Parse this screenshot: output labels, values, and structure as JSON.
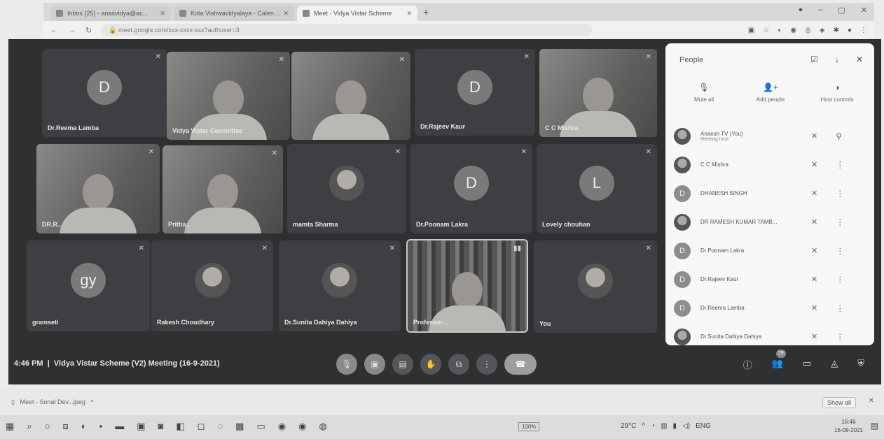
{
  "browser": {
    "tabs": [
      {
        "label": "Inbox (25) - anasvidya@ac...",
        "active": false
      },
      {
        "label": "Kota Vishwavidyalaya - Calendar",
        "active": false
      },
      {
        "label": "Meet - Vidya Vistar Scheme",
        "active": true
      }
    ],
    "new_tab": "+",
    "url": "meet.google.com/xxx-xxxx-xxx?authuser=3",
    "window_controls": [
      "●",
      "–",
      "▢",
      "✕"
    ]
  },
  "tiles": [
    {
      "name": "Dr.Reema Lamba",
      "kind": "letter",
      "letter": "D"
    },
    {
      "name": "Vidya Vistar Committee",
      "kind": "video"
    },
    {
      "name": "",
      "kind": "video"
    },
    {
      "name": "Dr.Rajeev Kaur",
      "kind": "letter",
      "letter": "D"
    },
    {
      "name": "C C Mishra",
      "kind": "video"
    },
    {
      "name": "DR.R...",
      "kind": "video"
    },
    {
      "name": "Pritha...",
      "kind": "video"
    },
    {
      "name": "mamta Sharma",
      "kind": "photo"
    },
    {
      "name": "Dr.Poonam Lakra",
      "kind": "letter",
      "letter": "D"
    },
    {
      "name": "Lovely chouhan",
      "kind": "letter",
      "letter": "L"
    },
    {
      "name": "gramseti",
      "kind": "letter",
      "letter": "gy"
    },
    {
      "name": "Rakesh Choudhary",
      "kind": "photo"
    },
    {
      "name": "Dr.Sunita Dahiya Dahiya",
      "kind": "photo"
    },
    {
      "name": "Professor...",
      "kind": "shelf"
    },
    {
      "name": "You",
      "kind": "photo"
    }
  ],
  "meeting": {
    "time": "4:46 PM",
    "title": "Vidya Vistar Scheme (V2) Meeting (16-9-2021)",
    "participant_count": "19"
  },
  "people_panel": {
    "title": "People",
    "actions": [
      {
        "label": "Mute all",
        "icon": "mic-off-icon"
      },
      {
        "label": "Add people",
        "icon": "person-add-icon"
      },
      {
        "label": "Host controls",
        "icon": "host-controls-icon"
      }
    ],
    "participants": [
      {
        "name": "Anaesh TV (You)",
        "sub": "Meeting host",
        "avatar": "photo",
        "letter": ""
      },
      {
        "name": "C C Mishra",
        "sub": "",
        "avatar": "photo",
        "letter": ""
      },
      {
        "name": "DHANESH SINGH",
        "sub": "",
        "avatar": "letter",
        "letter": "D"
      },
      {
        "name": "DR RAMESH KUMAR TAMB...",
        "sub": "",
        "avatar": "photo",
        "letter": ""
      },
      {
        "name": "Dr.Poonam Lakra",
        "sub": "",
        "avatar": "letter",
        "letter": "D"
      },
      {
        "name": "Dr.Rajeev Kaur",
        "sub": "",
        "avatar": "letter",
        "letter": "D"
      },
      {
        "name": "Dr.Reema Lamba",
        "sub": "",
        "avatar": "letter",
        "letter": "D"
      },
      {
        "name": "Dr.Sunita Dahiya Dahiya",
        "sub": "",
        "avatar": "photo",
        "letter": ""
      }
    ]
  },
  "download_bar": {
    "item": "Meet - Sonal Dev...jpeg",
    "show_all": "Show all"
  },
  "taskbar": {
    "zoom": "100%",
    "temperature": "29°C",
    "language": "ENG",
    "time": "16:46",
    "date": "16-09-2021"
  }
}
